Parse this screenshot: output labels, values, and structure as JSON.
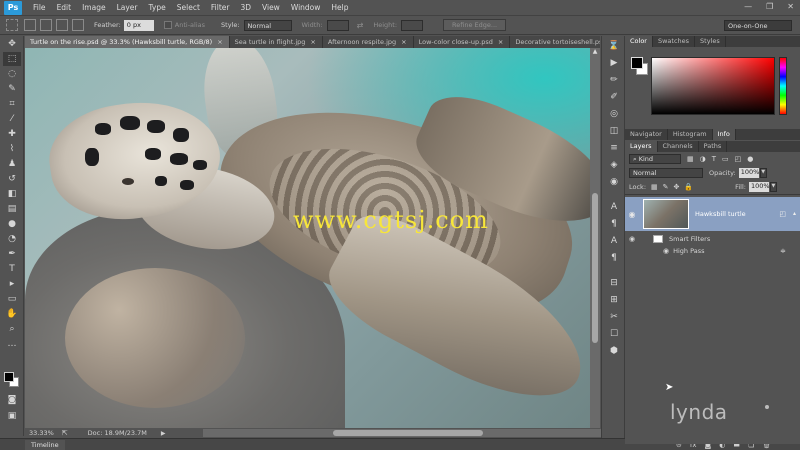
{
  "app": {
    "logo": "Ps"
  },
  "menu": [
    "File",
    "Edit",
    "Image",
    "Layer",
    "Type",
    "Select",
    "Filter",
    "3D",
    "View",
    "Window",
    "Help"
  ],
  "window_controls": {
    "minimize": "—",
    "restore": "❐",
    "close": "✕"
  },
  "options": {
    "feather_label": "Feather:",
    "feather_value": "0 px",
    "antialias_label": "Anti-alias",
    "style_label": "Style:",
    "style_value": "Normal",
    "width_label": "Width:",
    "height_label": "Height:",
    "refine_edge": "Refine Edge...",
    "workspace": "One-on-One"
  },
  "document_tabs": [
    {
      "label": "Turtle on the rise.psd @ 33.3% (Hawksbill turtle, RGB/8)",
      "active": true
    },
    {
      "label": "Sea turtle in flight.jpg",
      "active": false
    },
    {
      "label": "Afternoon respite.jpg",
      "active": false
    },
    {
      "label": "Low-color close-up.psd",
      "active": false
    },
    {
      "label": "Decorative tortoiseshell.psc",
      "active": false
    }
  ],
  "tab_close": "×",
  "watermark": "www.cgtsj.com",
  "status": {
    "zoom": "33.33%",
    "doc_size": "Doc: 18.9M/23.7M"
  },
  "timeline_label": "Timeline",
  "color_panel": {
    "tabs": [
      "Color",
      "Swatches",
      "Styles"
    ]
  },
  "info_panel": {
    "tabs": [
      "Navigator",
      "Histogram",
      "Info"
    ]
  },
  "layers_panel": {
    "tabs": [
      "Layers",
      "Channels",
      "Paths"
    ],
    "kind": "Kind",
    "blend_mode": "Normal",
    "opacity_label": "Opacity:",
    "opacity_value": "100%",
    "lock_label": "Lock:",
    "fill_label": "Fill:",
    "fill_value": "100%",
    "layers": [
      {
        "name": "Hawksbill turtle"
      }
    ],
    "smart_filters_label": "Smart Filters",
    "filters": [
      "High Pass"
    ],
    "footer_icons": [
      "link-icon",
      "fx-icon",
      "mask-icon",
      "adjustment-icon",
      "folder-icon",
      "new-layer-icon",
      "trash-icon"
    ]
  },
  "branding": "lynda",
  "colors": {
    "accent": "#2b9ad9",
    "layer_selected": "#8aa0c2",
    "watermark": "#f7e63a"
  }
}
